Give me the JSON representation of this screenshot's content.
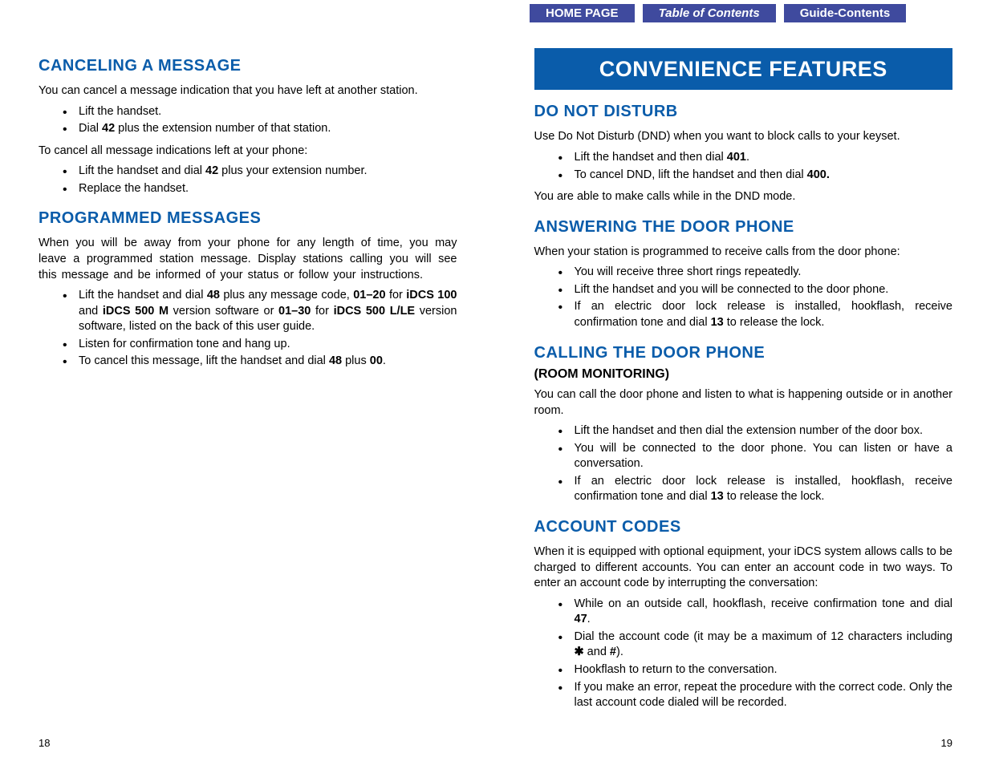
{
  "nav": {
    "home": "HOME PAGE",
    "toc": "Table of Contents",
    "guide": "Guide-Contents"
  },
  "left": {
    "h1": "CANCELING A MESSAGE",
    "p1": "You can cancel a message indication that you have left at another station.",
    "b1a": "Lift the handset.",
    "b1b_pre": "Dial ",
    "b1b_bold": "42",
    "b1b_post": " plus the extension number of that station.",
    "p2": "To cancel all message indications left at your phone:",
    "b2a_pre": "Lift the handset and dial ",
    "b2a_bold": "42",
    "b2a_post": " plus your extension number.",
    "b2b": "Replace the handset.",
    "h2": "PROGRAMMED MESSAGES",
    "p3": "When you will be away from your phone for any length of time, you may leave a programmed station message. Display stations calling you will see this message and be informed of your status or follow your instructions.",
    "b3a_1": "Lift the handset and dial ",
    "b3a_2": "48",
    "b3a_3": " plus any message code, ",
    "b3a_4": "01–20",
    "b3a_5": " for ",
    "b3a_6": "iDCS 100",
    "b3a_7": " and ",
    "b3a_8": "iDCS 500 M",
    "b3a_9": " version software or ",
    "b3a_10": "01–30",
    "b3a_11": " for ",
    "b3a_12": "iDCS 500 L/LE",
    "b3a_13": " version software, listed on the back of this user guide.",
    "b3b": "Listen for confirmation tone and hang up.",
    "b3c_1": "To cancel this message, lift the handset and dial ",
    "b3c_2": "48",
    "b3c_3": " plus ",
    "b3c_4": "00",
    "b3c_5": ".",
    "pagenum": "18"
  },
  "right": {
    "banner": "CONVENIENCE FEATURES",
    "h1": "DO NOT DISTURB",
    "p1": "Use Do Not Disturb (DND) when you want to block calls to your keyset.",
    "b1a_1": "Lift the handset and then dial ",
    "b1a_2": "401",
    "b1a_3": ".",
    "b1b_1": "To cancel DND, lift the handset and then dial ",
    "b1b_2": "400.",
    "p2": "You are able to make calls while in the DND mode.",
    "h2": "ANSWERING THE DOOR PHONE",
    "p3": "When your station is programmed to receive calls from the door phone:",
    "b2a": "You will receive three short rings repeatedly.",
    "b2b": "Lift the handset and you will be connected to the door phone.",
    "b2c_1": "If an electric door lock release is installed, hookflash, receive confirmation tone and dial ",
    "b2c_2": "13",
    "b2c_3": " to release the lock.",
    "h3": "CALLING THE DOOR PHONE",
    "sub3": "(ROOM MONITORING)",
    "p4": "You can call the door phone and listen to what is happening outside or in another room.",
    "b3a": "Lift the handset and then dial the extension number of the door box.",
    "b3b": "You will be connected to the door phone. You can listen or have a conversation.",
    "b3c_1": "If an electric door lock release is installed, hookflash, receive confirmation tone and dial ",
    "b3c_2": "13",
    "b3c_3": " to release the lock.",
    "h4": "ACCOUNT CODES",
    "p5": "When it is equipped with optional equipment, your iDCS system allows calls to be charged to different accounts. You can enter an account code in two ways. To enter an account code by interrupting the conversation:",
    "b4a_1": "While on an outside call, hookflash, receive confirmation tone and dial ",
    "b4a_2": "47",
    "b4a_3": ".",
    "b4b_1": "Dial the account code (it may be a maximum of 12 characters including ",
    "b4b_2": "✱",
    "b4b_3": " and ",
    "b4b_4": "#",
    "b4b_5": ").",
    "b4c": "Hookflash to return to the conversation.",
    "b4d": "If you make an error, repeat the procedure with the correct code. Only the last account code dialed will be recorded.",
    "pagenum": "19"
  }
}
